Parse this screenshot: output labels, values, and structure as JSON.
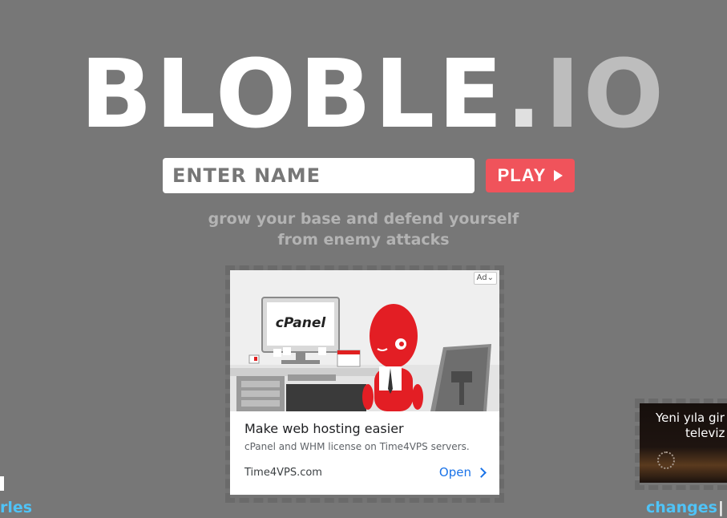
{
  "logo": {
    "main": "BLOBLE",
    "dot": ".",
    "tld": "IO"
  },
  "name_input": {
    "placeholder": "ENTER NAME",
    "value": ""
  },
  "play_button": {
    "label": "PLAY"
  },
  "tagline": {
    "line1": "grow your base and defend yourself",
    "line2": "from enemy attacks"
  },
  "ad": {
    "badge": "Ad",
    "illustration_text": "cPanel",
    "headline": "Make web hosting easier",
    "description": "cPanel and WHM license on Time4VPS servers.",
    "url": "Time4VPS.com",
    "cta": "Open"
  },
  "side_ad": {
    "line1": "Yeni yıla gir",
    "line2": "televiz"
  },
  "footer": {
    "left_link": "rles",
    "right_link": "changes",
    "separator": "|"
  },
  "colors": {
    "background": "#777777",
    "play": "#f0535b",
    "link": "#4fc3f7",
    "tagline": "#b3b3b3"
  },
  "icons": {
    "play": "play-triangle-icon",
    "open": "chevron-right-icon",
    "ad_menu": "chevron-down-icon"
  }
}
